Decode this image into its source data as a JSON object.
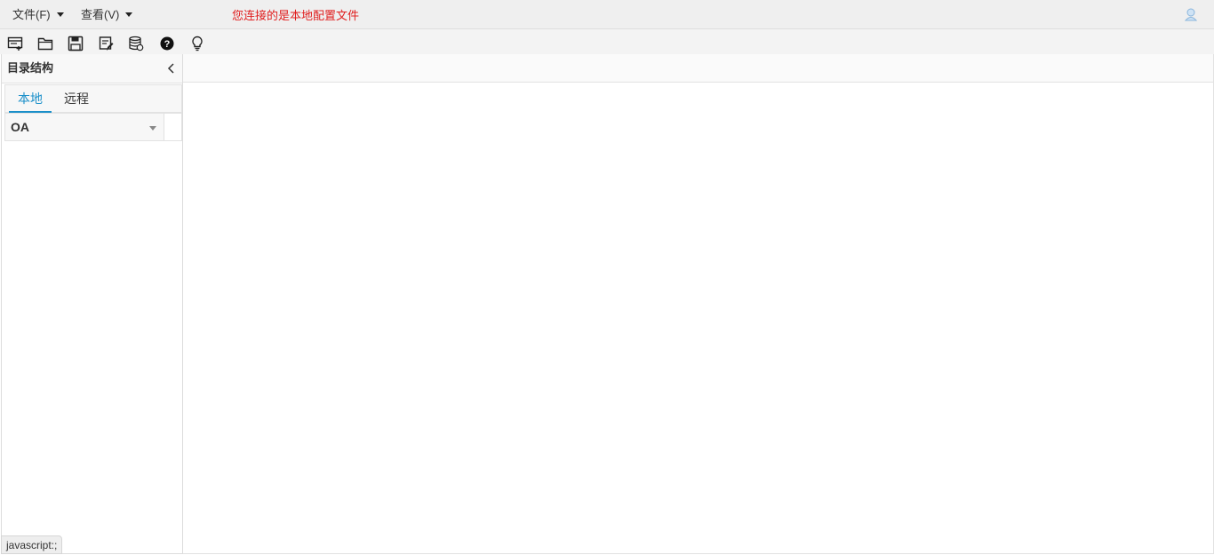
{
  "menubar": {
    "file_menu": "文件(F)",
    "view_menu": "查看(V)",
    "notice": "您连接的是本地配置文件",
    "user_icon": "user-icon"
  },
  "toolbar": {
    "tools": [
      "new-template-icon",
      "open-folder-icon",
      "save-icon",
      "edit-doc-icon",
      "database-icon",
      "help-icon",
      "lightbulb-icon"
    ]
  },
  "sidebar": {
    "title": "目录结构",
    "collapse_icon": "chevron-left-icon",
    "tabs": [
      {
        "label": "本地",
        "active": true
      },
      {
        "label": "远程",
        "active": false
      }
    ],
    "selected_value": "OA"
  },
  "status": {
    "link_text": "javascript:;"
  },
  "colors": {
    "notice": "#e02020",
    "active_tab": "#1a8fc9",
    "menubar_bg": "#efefef"
  }
}
